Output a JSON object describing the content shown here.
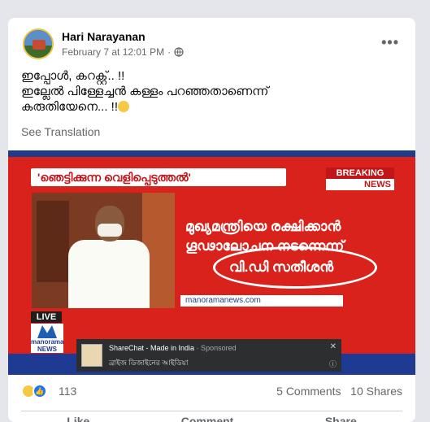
{
  "post": {
    "author": "Hari Narayanan",
    "date": "February 7 at 12:01 PM",
    "separator": "·",
    "privacy_icon": "globe-icon",
    "more_icon": "more-options-icon",
    "more_glyph": "•••",
    "lines": [
      "ഇപ്പോൾ, കറക്റ്റ്.. !!",
      "ഇല്ലേൽ പിള്ളേച്ചൻ കള്ളം പറഞ്ഞതാണെന്ന്"
    ],
    "line3": "കരുതിയേനെ... !!",
    "see_translation": "See Translation"
  },
  "media": {
    "headline": "'ഞെട്ടിക്കുന്ന വെളിപ്പെടുത്തൽ'",
    "breaking_top": "BREAKING",
    "breaking_bottom": "NEWS",
    "main_line1": "മുഖ്യമന്ത്രിയെ രക്ഷിക്കാൻ",
    "main_line2": "ഗൂഢാലോചന നടന്നെന്ന്",
    "main_line3": "വി.ഡി സതീശൻ",
    "site": "manoramanews.com",
    "live": "LIVE",
    "channel": "manorama NEWS",
    "ad_title": "ShareChat - Made in India",
    "ad_sponsored": " · Sponsored",
    "ad_subtitle": "ব্রাইজ ডিজাইনের আইডিয়া",
    "ad_close": "✕",
    "ad_info": "ⓘ"
  },
  "stats": {
    "reactions": [
      "haha",
      "like"
    ],
    "reaction_count": "113",
    "comments": "5 Comments",
    "shares": "10 Shares"
  },
  "actions": [
    "Like",
    "Comment",
    "Share"
  ]
}
